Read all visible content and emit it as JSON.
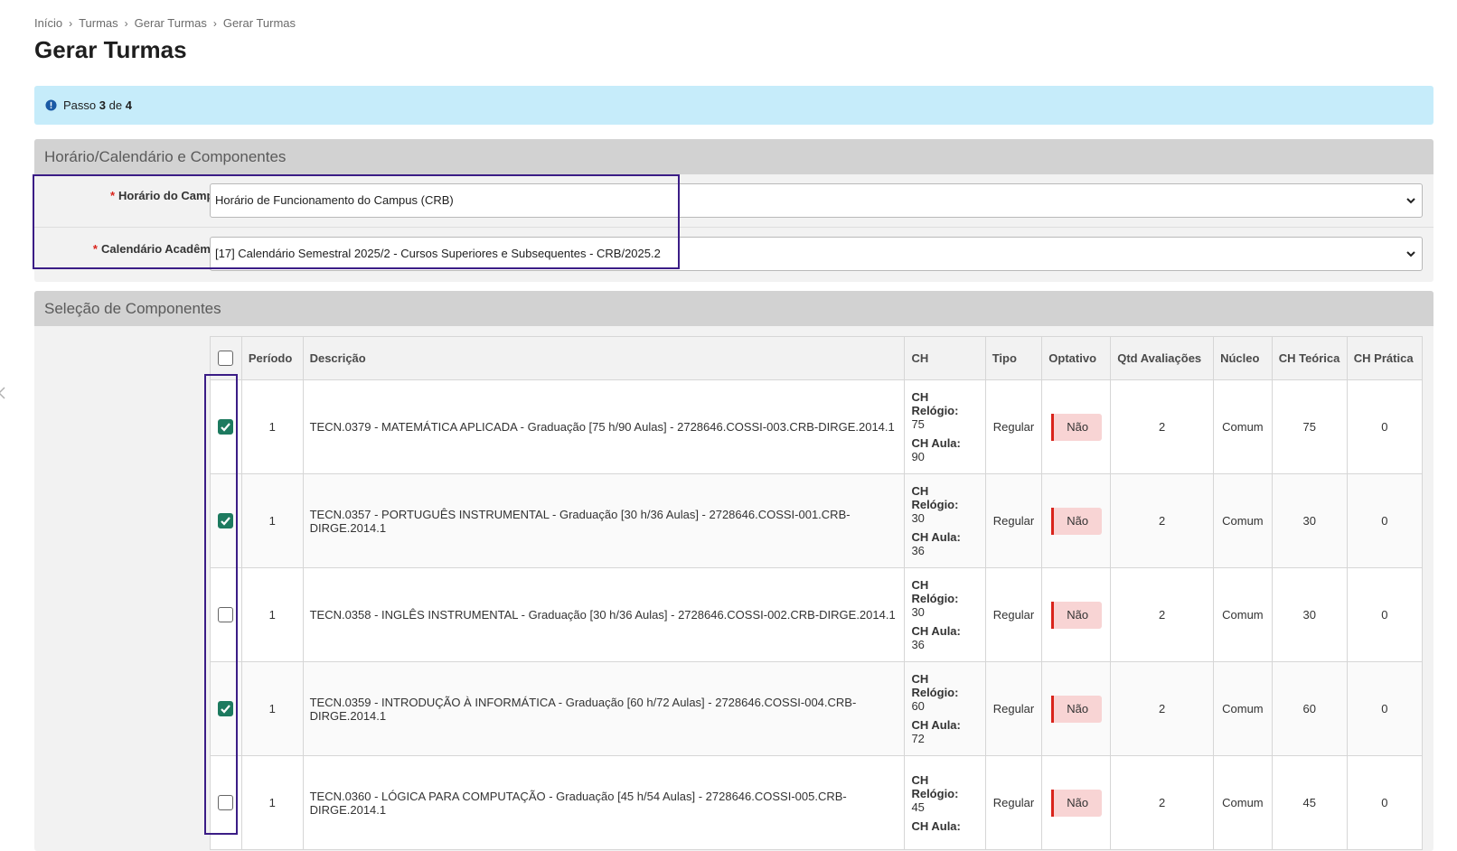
{
  "breadcrumb": [
    "Início",
    "Turmas",
    "Gerar Turmas",
    "Gerar Turmas"
  ],
  "page_title": "Gerar Turmas",
  "alert": {
    "prefix": "Passo",
    "step": "3",
    "middle": "de",
    "total": "4"
  },
  "section1": {
    "title": "Horário/Calendário e Componentes",
    "campus_label": "Horário do Campus:",
    "campus_value": "Horário de Funcionamento do Campus (CRB)",
    "calendar_label": "Calendário Acadêmico:",
    "calendar_value": "[17] Calendário Semestral 2025/2 - Cursos Superiores e Subsequentes - CRB/2025.2"
  },
  "section2": {
    "title": "Seleção de Componentes",
    "columns": [
      "Período",
      "Descrição",
      "CH",
      "Tipo",
      "Optativo",
      "Qtd Avaliações",
      "Núcleo",
      "CH Teórica",
      "CH Prática"
    ],
    "ch_relogio_label": "CH Relógio:",
    "ch_aula_label": "CH Aula:",
    "rows": [
      {
        "checked": true,
        "periodo": "1",
        "descricao": "TECN.0379 - MATEMÁTICA APLICADA - Graduação [75 h/90 Aulas] - 2728646.COSSI-003.CRB-DIRGE.2014.1",
        "ch_relogio": "75",
        "ch_aula": "90",
        "tipo": "Regular",
        "optativo": "Não",
        "qtd": "2",
        "nucleo": "Comum",
        "ch_teorica": "75",
        "ch_pratica": "0"
      },
      {
        "checked": true,
        "periodo": "1",
        "descricao": "TECN.0357 - PORTUGUÊS INSTRUMENTAL - Graduação [30 h/36 Aulas] - 2728646.COSSI-001.CRB-DIRGE.2014.1",
        "ch_relogio": "30",
        "ch_aula": "36",
        "tipo": "Regular",
        "optativo": "Não",
        "qtd": "2",
        "nucleo": "Comum",
        "ch_teorica": "30",
        "ch_pratica": "0"
      },
      {
        "checked": false,
        "periodo": "1",
        "descricao": "TECN.0358 - INGLÊS INSTRUMENTAL - Graduação [30 h/36 Aulas] - 2728646.COSSI-002.CRB-DIRGE.2014.1",
        "ch_relogio": "30",
        "ch_aula": "36",
        "tipo": "Regular",
        "optativo": "Não",
        "qtd": "2",
        "nucleo": "Comum",
        "ch_teorica": "30",
        "ch_pratica": "0"
      },
      {
        "checked": true,
        "periodo": "1",
        "descricao": "TECN.0359 - INTRODUÇÃO À INFORMÁTICA - Graduação [60 h/72 Aulas] - 2728646.COSSI-004.CRB-DIRGE.2014.1",
        "ch_relogio": "60",
        "ch_aula": "72",
        "tipo": "Regular",
        "optativo": "Não",
        "qtd": "2",
        "nucleo": "Comum",
        "ch_teorica": "60",
        "ch_pratica": "0"
      },
      {
        "checked": false,
        "periodo": "1",
        "descricao": "TECN.0360 - LÓGICA PARA COMPUTAÇÃO - Graduação [45 h/54 Aulas] - 2728646.COSSI-005.CRB-DIRGE.2014.1",
        "ch_relogio": "45",
        "ch_aula": "",
        "tipo": "Regular",
        "optativo": "Não",
        "qtd": "2",
        "nucleo": "Comum",
        "ch_teorica": "45",
        "ch_pratica": "0"
      }
    ]
  },
  "colors": {
    "alert_bg": "#c6ecfa",
    "highlight": "#3b1d86",
    "checkbox_checked": "#1d7a5f",
    "badge_bg": "#f8d4d4",
    "badge_border": "#d9241c",
    "required": "#d9241c"
  }
}
